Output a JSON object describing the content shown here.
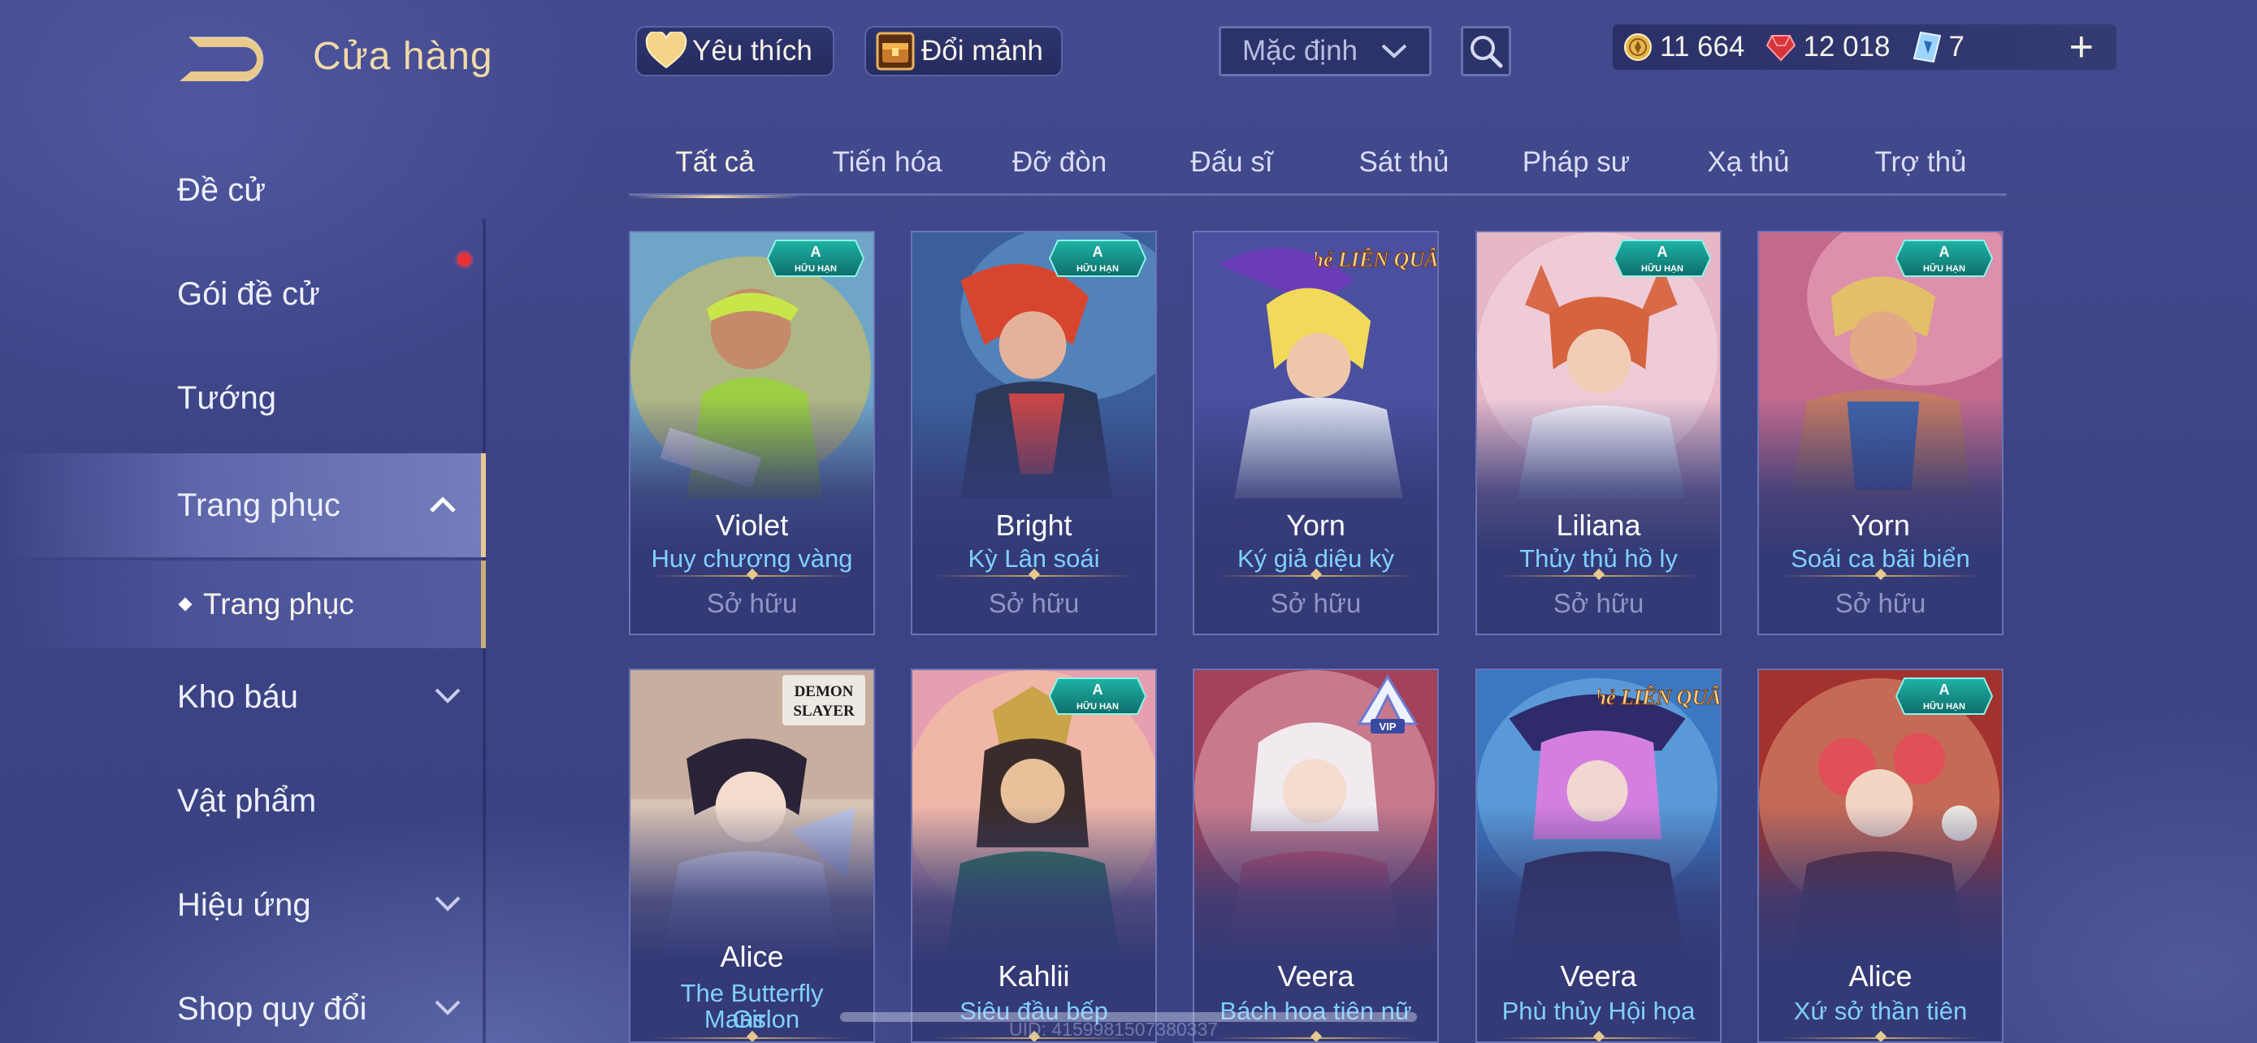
{
  "header": {
    "title": "Cửa hàng",
    "favorite_label": "Yêu thích",
    "exchange_label": "Đổi mảnh",
    "sort_value": "Mặc định"
  },
  "currency": {
    "gold": "11 664",
    "gems": "12 018",
    "vouchers": "7"
  },
  "sidebar": {
    "items": [
      {
        "label": "Đề cử"
      },
      {
        "label": "Gói đề cử"
      },
      {
        "label": "Tướng"
      },
      {
        "label": "Trang phục"
      },
      {
        "label": "Kho báu"
      },
      {
        "label": "Vật phẩm"
      },
      {
        "label": "Hiệu ứng"
      },
      {
        "label": "Shop quy đổi"
      }
    ],
    "sub_item": "Trang phục"
  },
  "tabs": [
    "Tất cả",
    "Tiến hóa",
    "Đỡ đòn",
    "Đấu sĩ",
    "Sát thủ",
    "Pháp sư",
    "Xạ thủ",
    "Trợ thủ"
  ],
  "cards": [
    {
      "hero": "Violet",
      "skin": "Huy chương vàng",
      "status": "Sở hữu",
      "badge": "A HỮU HẠN"
    },
    {
      "hero": "Bright",
      "skin": "Kỳ Lân soái",
      "status": "Sở hữu",
      "badge": "A HỮU HẠN"
    },
    {
      "hero": "Yorn",
      "skin": "Ký giả diệu kỳ",
      "status": "Sở hữu",
      "badge": "THẺ LIÊN QUÂN"
    },
    {
      "hero": "Liliana",
      "skin": "Thủy thủ hồ ly",
      "status": "Sở hữu",
      "badge": "A HỮU HẠN"
    },
    {
      "hero": "Yorn",
      "skin": "Soái ca bãi biển",
      "status": "Sở hữu",
      "badge": "A HỮU HẠN"
    },
    {
      "hero": "Alice",
      "skin": "The Butterfly Mansion Girl",
      "skin_line1": "The Butterfly Mansion",
      "skin_line2": "Girl",
      "badge": "DEMON SLAYER"
    },
    {
      "hero": "Kahlii",
      "skin": "Siêu đầu bếp",
      "badge": "A HỮU HẠN"
    },
    {
      "hero": "Veera",
      "skin": "Bách hoa tiên nữ",
      "badge": "A VIP"
    },
    {
      "hero": "Veera",
      "skin": "Phù thủy Hội họa",
      "badge": "THẺ LIÊN QUÂN"
    },
    {
      "hero": "Alice",
      "skin": "Xứ sở thần tiên",
      "badge": "A HỮU HẠN"
    }
  ],
  "footer": {
    "uid": "UID: 4159981507380337"
  },
  "colors": {
    "background": "#3e4588",
    "accent_gold": "#f0d79e",
    "skin_name": "#7fd0ff",
    "notification": "#e8303a"
  }
}
